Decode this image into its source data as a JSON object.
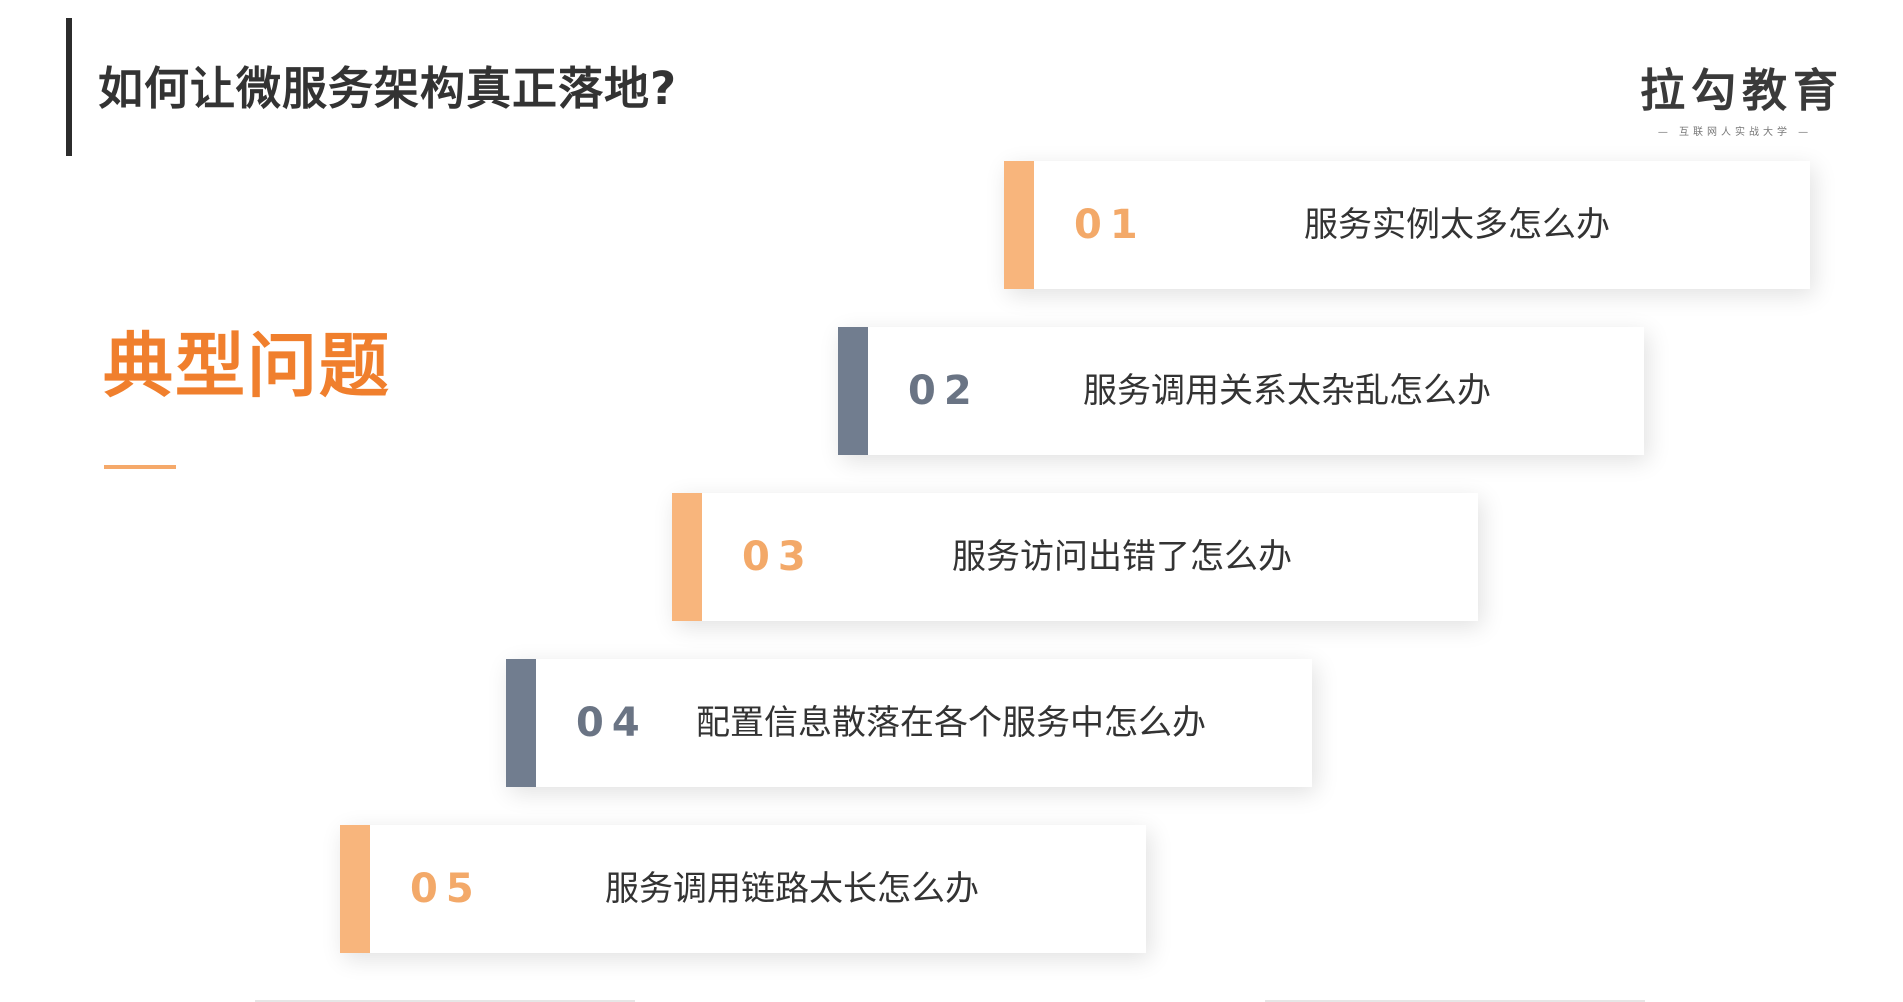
{
  "header": {
    "title": "如何让微服务架构真正落地?"
  },
  "logo": {
    "main": "拉勾教育",
    "sub": "— 互联网人实战大学 —"
  },
  "section": {
    "heading": "典型问题"
  },
  "colors": {
    "orange_accent": "#f8b57c",
    "orange_number": "#f3a969",
    "gray_accent": "#717d8f",
    "gray_number": "#6a7484",
    "heading_orange": "#f07f2d"
  },
  "items": [
    {
      "number": "01",
      "text": "服务实例太多怎么办",
      "style": "orange"
    },
    {
      "number": "02",
      "text": "服务调用关系太杂乱怎么办",
      "style": "gray"
    },
    {
      "number": "03",
      "text": "服务访问出错了怎么办",
      "style": "orange"
    },
    {
      "number": "04",
      "text": "配置信息散落在各个服务中怎么办",
      "style": "gray"
    },
    {
      "number": "05",
      "text": "服务调用链路太长怎么办",
      "style": "orange"
    }
  ]
}
